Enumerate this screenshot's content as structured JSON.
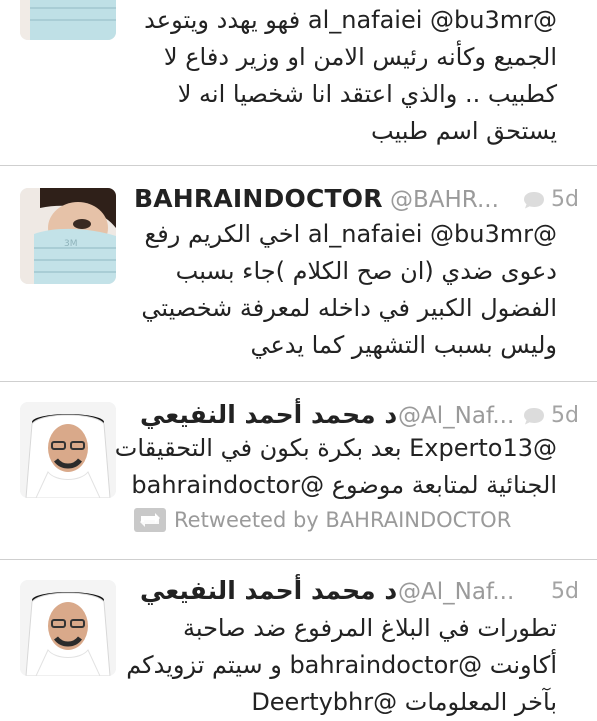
{
  "tweets": [
    {
      "lines": [
        "@al_nafaiei @bu3mr فهو يهدد ويتوعد",
        "الجميع وكأنه رئيس الامن او وزير دفاع لا",
        "كطبيب .. والذي اعتقد انا شخصيا انه لا",
        "يستحق اسم طبيب"
      ]
    },
    {
      "name": "BAHRAINDOCTOR",
      "handle": "@BAHR...",
      "time": "5d",
      "lines": [
        "@al_nafaiei @bu3mr اخي الكريم رفع",
        "دعوى ضدي (ان صح الكلام )جاء بسبب",
        "الفضول الكبير في داخله لمعرفة شخصيتي",
        "وليس بسبب التشهير كما يدعي"
      ]
    },
    {
      "name": "د محمد أحمد النفيعي",
      "handle": "@Al_Naf...",
      "time": "5d",
      "lines": [
        "@Experto13 بعد بكرة بكون في التحقيقات",
        "الجنائية لمتابعة موضوع @bahraindoctor"
      ],
      "retweeted_by": "Retweeted by BAHRAINDOCTOR"
    },
    {
      "name": "د محمد أحمد النفيعي",
      "handle": "@Al_Naf...",
      "time": "5d",
      "lines": [
        "تطورات في البلاغ المرفوع ضد صاحبة",
        "أكاونت @bahraindoctor و سيتم تزويدكم",
        "بآخر المعلومات @Deertybhr"
      ]
    }
  ],
  "icons": {
    "reply_bubble": "speech-bubble-icon",
    "retweet": "retweet-icon"
  },
  "colors": {
    "text": "#222222",
    "secondary": "#9a9a9a",
    "divider": "#cfcfcf"
  }
}
